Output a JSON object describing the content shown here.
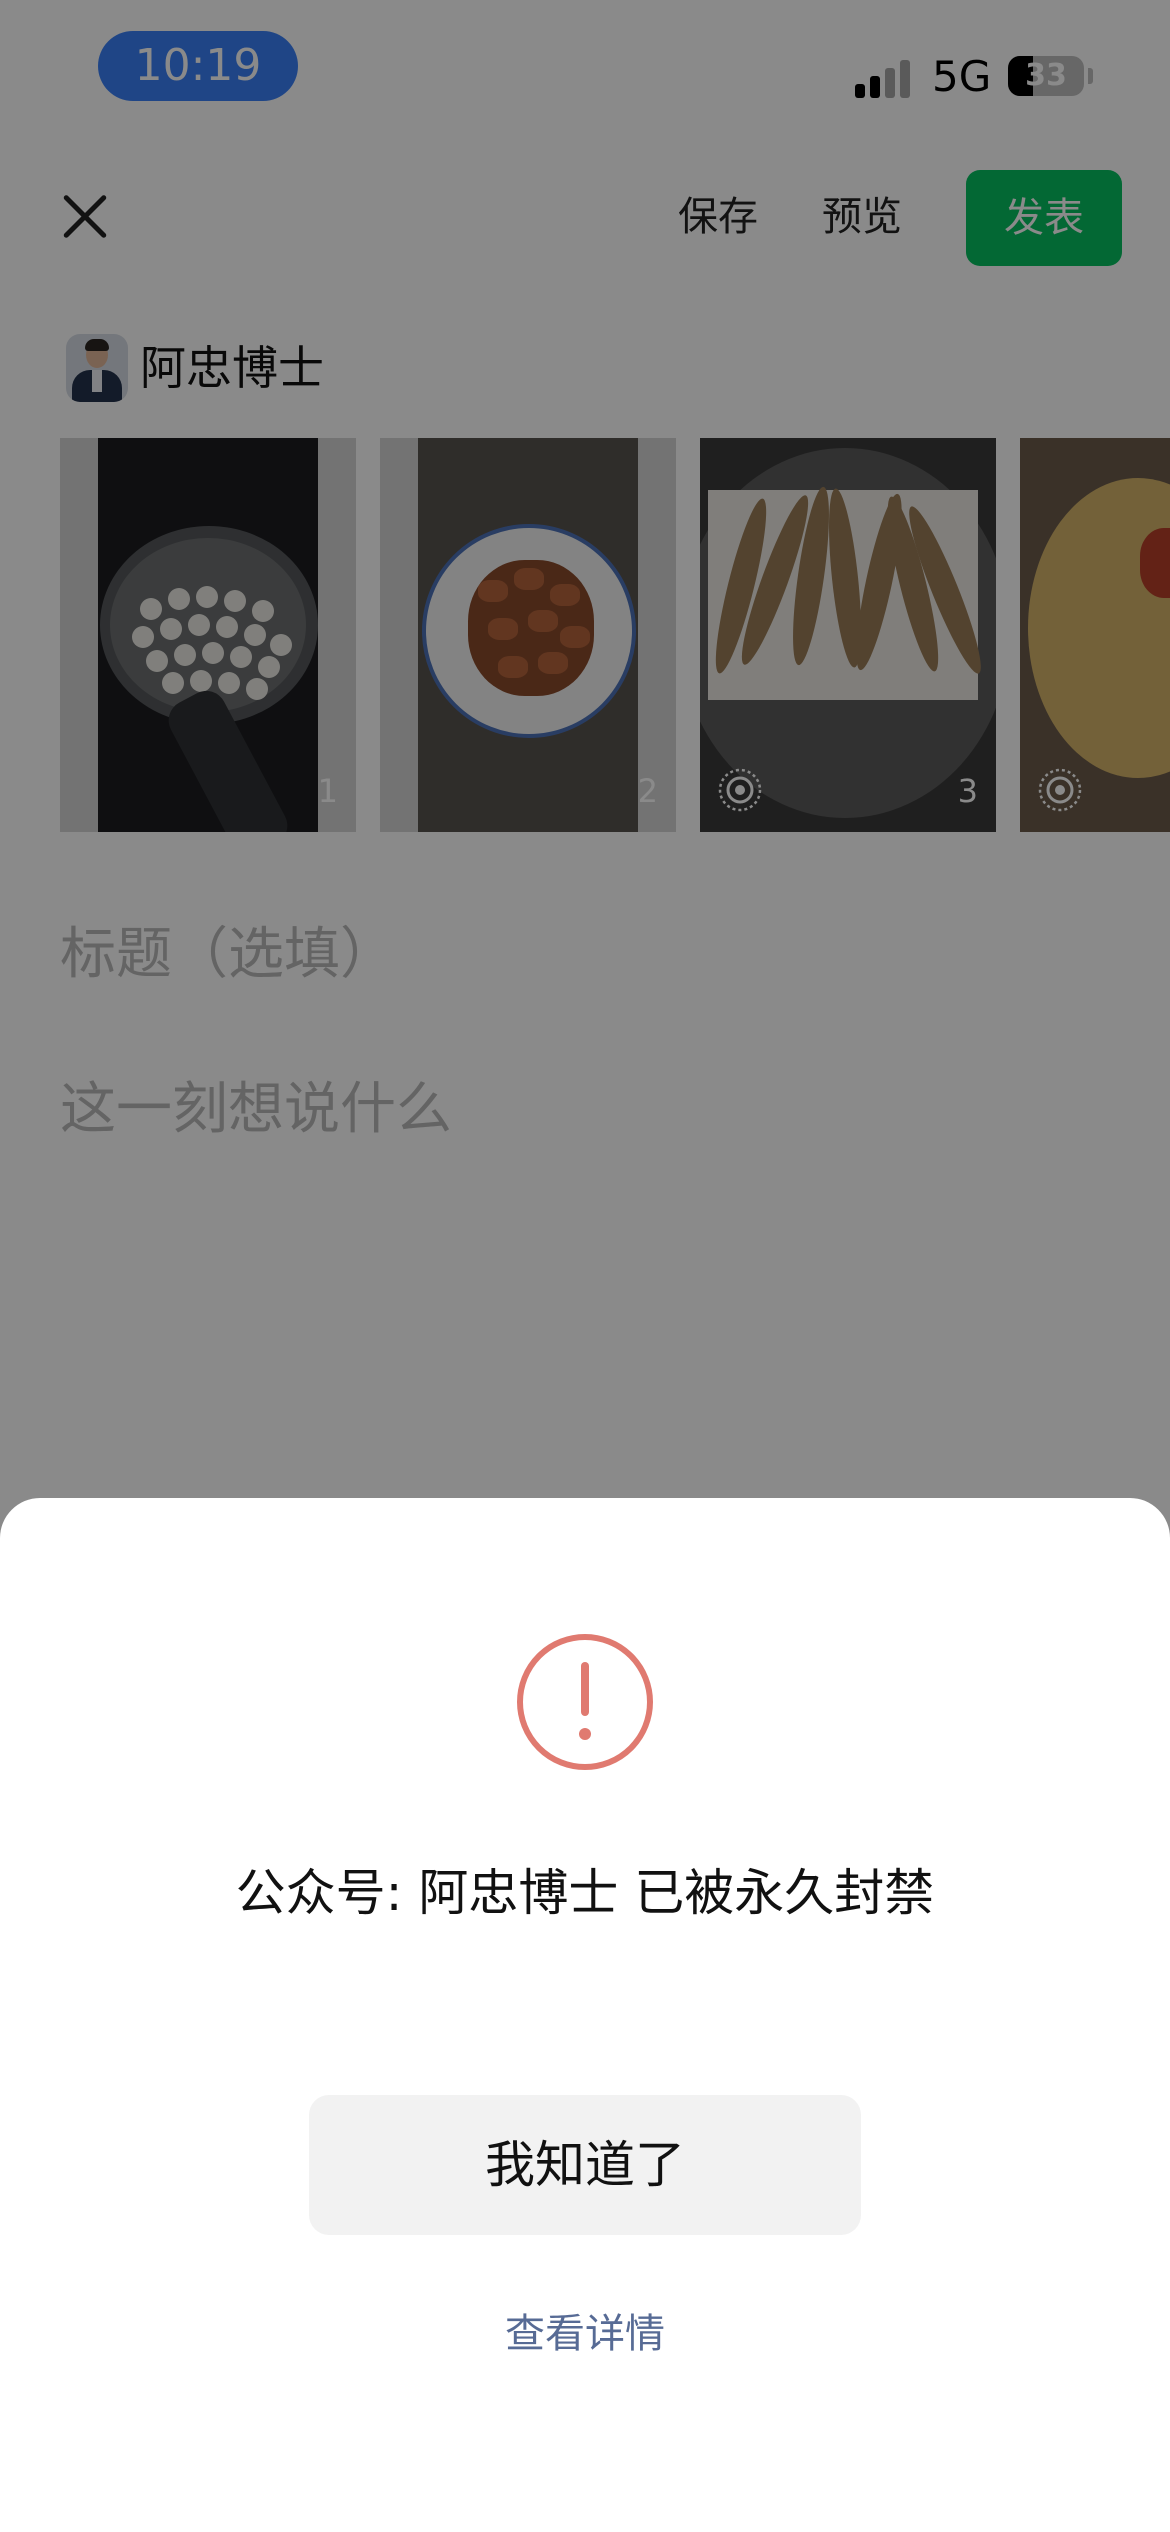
{
  "status_bar": {
    "time": "10:19",
    "network": "5G",
    "battery_percent": "33",
    "battery_level": 0.33
  },
  "top_bar": {
    "save_label": "保存",
    "preview_label": "预览",
    "publish_label": "发表",
    "publish_color": "#07c160"
  },
  "author": {
    "name": "阿忠博士"
  },
  "gallery": {
    "items": [
      {
        "subject": "pan-of-meatballs",
        "index": "1",
        "live": false
      },
      {
        "subject": "bowl-of-fried-pork",
        "index": "2",
        "live": false
      },
      {
        "subject": "fried-fish-on-plate",
        "index": "3",
        "live": true
      },
      {
        "subject": "soup-bowl",
        "index": "",
        "live": true
      }
    ]
  },
  "editor": {
    "title_placeholder": "标题（选填）",
    "body_placeholder": "这一刻想说什么"
  },
  "dialog": {
    "icon": "exclamation-circle-icon",
    "icon_color": "#e07a70",
    "message": "公众号: 阿忠博士 已被永久封禁",
    "ack_label": "我知道了",
    "details_label": "查看详情",
    "details_color": "#576b95"
  }
}
